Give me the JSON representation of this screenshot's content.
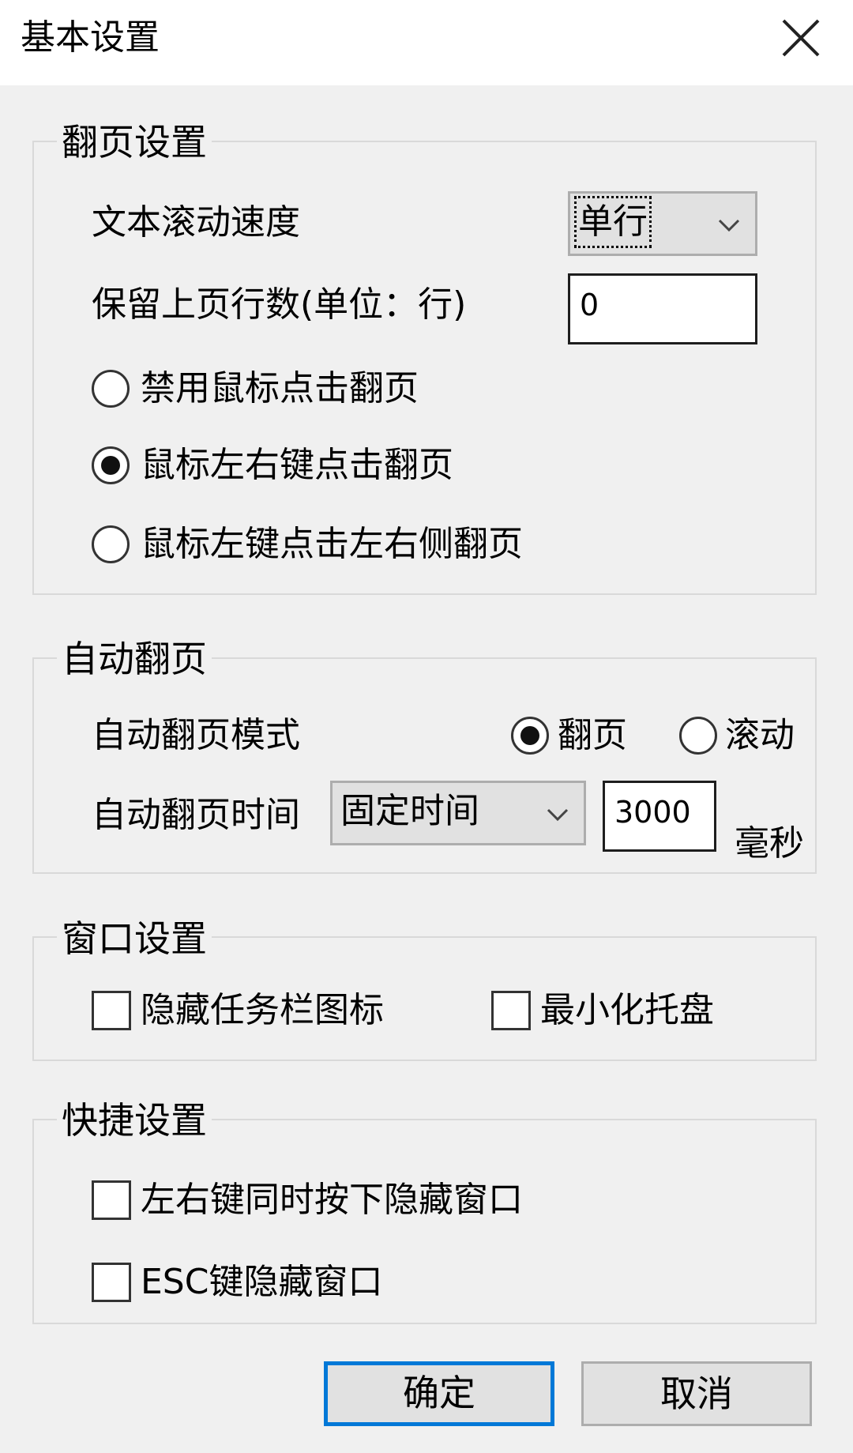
{
  "window": {
    "title": "基本设置"
  },
  "page_turn": {
    "legend": "翻页设置",
    "scroll_speed_label": "文本滚动速度",
    "scroll_speed_value": "单行",
    "keep_lines_label": "保留上页行数(单位：行)",
    "keep_lines_value": "0",
    "options": [
      {
        "label": "禁用鼠标点击翻页",
        "checked": false
      },
      {
        "label": "鼠标左右键点击翻页",
        "checked": true
      },
      {
        "label": "鼠标左键点击左右侧翻页",
        "checked": false
      }
    ]
  },
  "auto_turn": {
    "legend": "自动翻页",
    "mode_label": "自动翻页模式",
    "mode_options": [
      {
        "label": "翻页",
        "checked": true
      },
      {
        "label": "滚动",
        "checked": false
      }
    ],
    "time_label": "自动翻页时间",
    "time_mode_value": "固定时间",
    "time_value": "3000",
    "time_unit": "毫秒"
  },
  "window_settings": {
    "legend": "窗口设置",
    "hide_taskbar_icon": {
      "label": "隐藏任务栏图标",
      "checked": false
    },
    "minimize_tray": {
      "label": "最小化托盘",
      "checked": false
    }
  },
  "shortcut_settings": {
    "legend": "快捷设置",
    "both_buttons_hide": {
      "label": "左右键同时按下隐藏窗口",
      "checked": false
    },
    "esc_hide": {
      "label": "ESC键隐藏窗口",
      "checked": false
    }
  },
  "buttons": {
    "ok": "确定",
    "cancel": "取消"
  },
  "colors": {
    "focus_accent": "#0078d7",
    "window_bg": "#f0f0f0"
  }
}
